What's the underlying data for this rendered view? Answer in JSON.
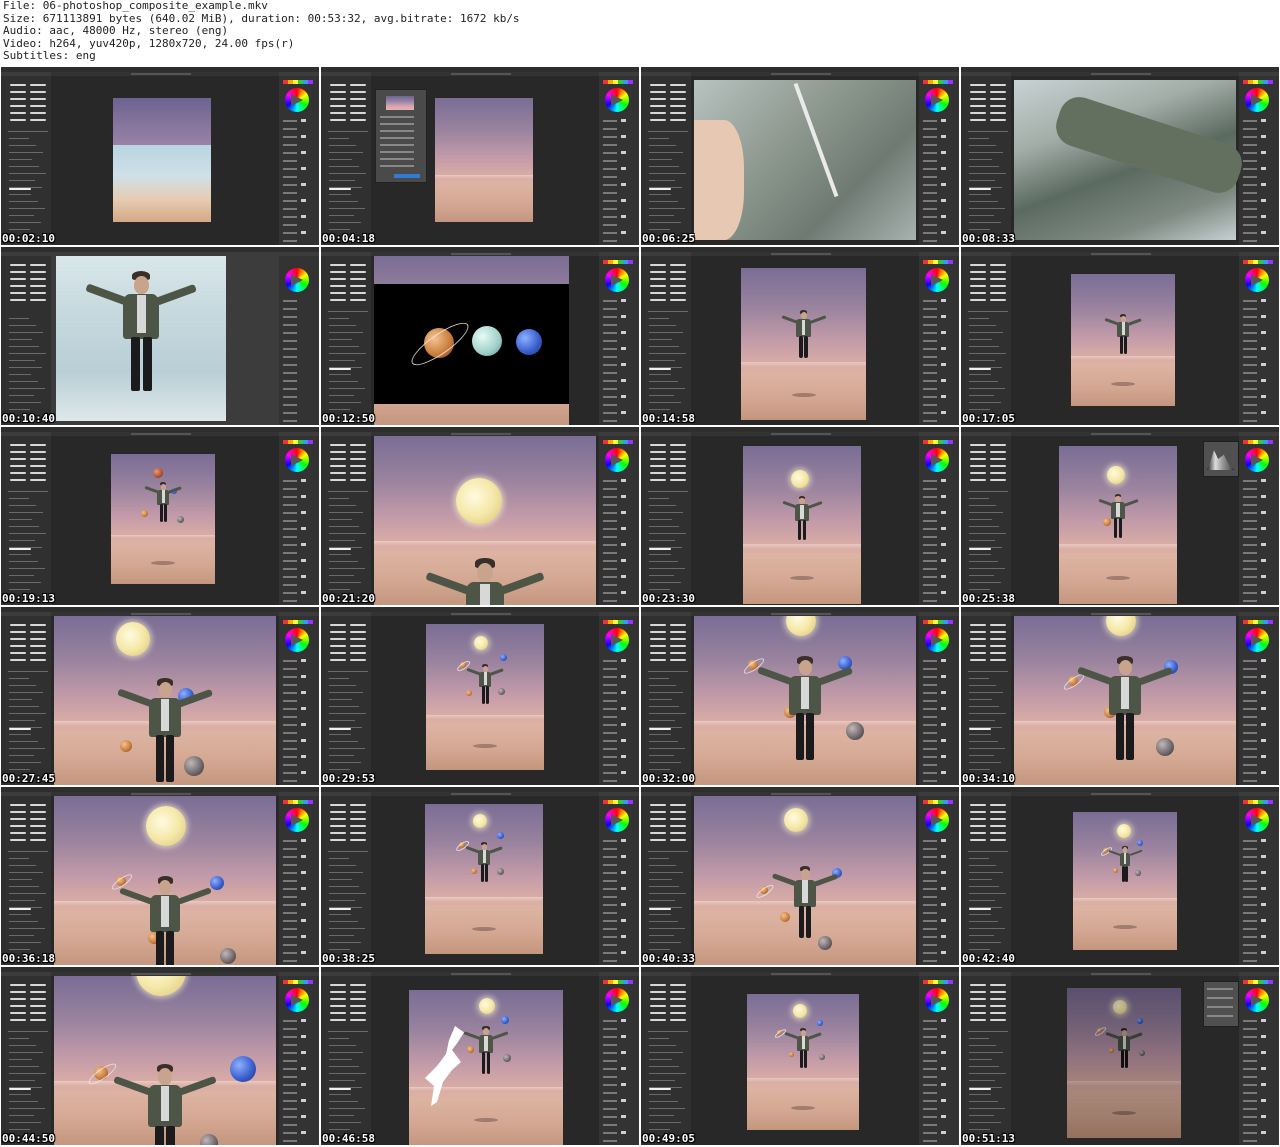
{
  "header": {
    "file_line": "File: 06-photoshop_composite_example.mkv",
    "size_line": "Size: 671113891 bytes (640.02 MiB), duration: 00:53:32, avg.bitrate: 1672 kb/s",
    "audio_line": "Audio: aac, 48000 Hz, stereo (eng)",
    "video_line": "Video: h264, yuv420p, 1280x720, 24.00 fps(r)",
    "subtitles_line": "Subtitles: eng"
  },
  "thumbnails": [
    {
      "timestamp": "00:02:10",
      "scene": "sky-desert-blend"
    },
    {
      "timestamp": "00:04:18",
      "scene": "sky-dialog"
    },
    {
      "timestamp": "00:06:25",
      "scene": "jacket-closeup"
    },
    {
      "timestamp": "00:08:33",
      "scene": "jacket-arm"
    },
    {
      "timestamp": "00:10:40",
      "scene": "studio-person"
    },
    {
      "timestamp": "00:12:50",
      "scene": "planets-source"
    },
    {
      "timestamp": "00:14:58",
      "scene": "person-desert"
    },
    {
      "timestamp": "00:17:05",
      "scene": "person-desert-small"
    },
    {
      "timestamp": "00:19:13",
      "scene": "planets-placed"
    },
    {
      "timestamp": "00:21:20",
      "scene": "moon-zoom"
    },
    {
      "timestamp": "00:23:30",
      "scene": "moon-person"
    },
    {
      "timestamp": "00:25:38",
      "scene": "moon-person-histogram"
    },
    {
      "timestamp": "00:27:45",
      "scene": "zoomed-composite"
    },
    {
      "timestamp": "00:29:53",
      "scene": "full-composite"
    },
    {
      "timestamp": "00:32:00",
      "scene": "zoomed-composite-2"
    },
    {
      "timestamp": "00:34:10",
      "scene": "zoomed-composite-3"
    },
    {
      "timestamp": "00:36:18",
      "scene": "zoomed-composite-4"
    },
    {
      "timestamp": "00:38:25",
      "scene": "full-composite-2"
    },
    {
      "timestamp": "00:40:33",
      "scene": "zoomed-composite-5"
    },
    {
      "timestamp": "00:42:40",
      "scene": "full-composite-3"
    },
    {
      "timestamp": "00:44:50",
      "scene": "zoomed-composite-6"
    },
    {
      "timestamp": "00:46:58",
      "scene": "bird-mask"
    },
    {
      "timestamp": "00:49:05",
      "scene": "full-composite-4"
    },
    {
      "timestamp": "00:51:13",
      "scene": "full-composite-dark"
    }
  ],
  "colors": {
    "ui_dark": "#3c3c3c",
    "canvas_bg": "#282828",
    "sky_top": "#7a6d95",
    "sand": "#d4a88d",
    "moon": "#f5e8a8"
  }
}
